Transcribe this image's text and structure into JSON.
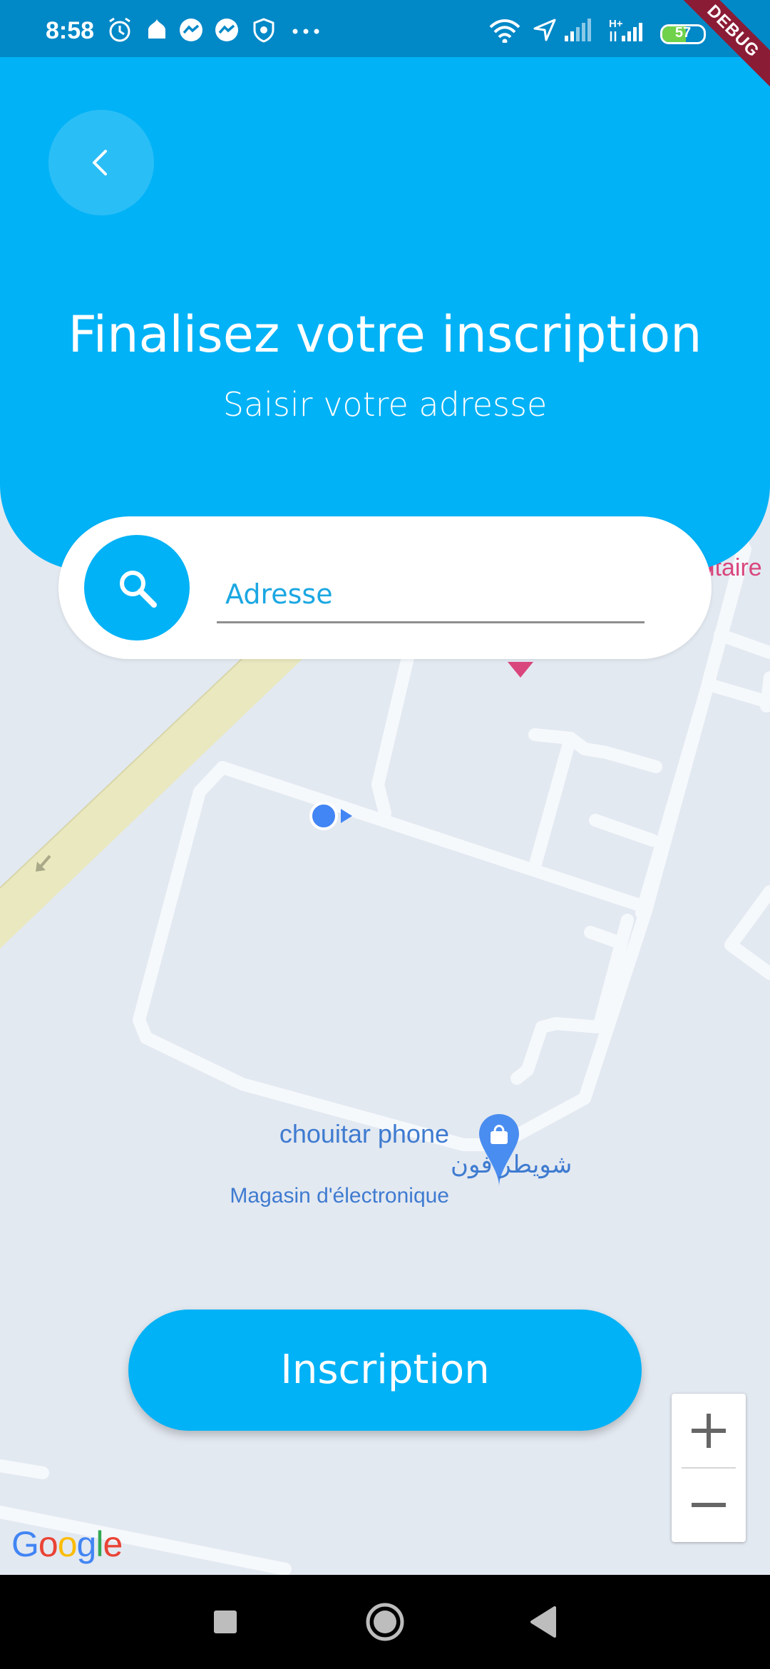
{
  "status_bar": {
    "time": "8:58",
    "battery_level": "57",
    "battery_fraction": 0.57,
    "debug_banner": "DEBUG",
    "left_icons": [
      "alarm-icon",
      "mosque-icon",
      "messenger-icon",
      "messenger-icon",
      "shield-icon",
      "more-icon"
    ],
    "right_icons": [
      "wifi-icon",
      "location-arrow-icon",
      "signal-icon",
      "hplus-signal-icon",
      "battery-icon"
    ]
  },
  "header": {
    "back_icon": "chevron-left-icon",
    "title": "Finalisez votre inscription",
    "subtitle": "Saisir votre adresse",
    "background_color": "#02b2f6"
  },
  "search": {
    "icon": "search-icon",
    "placeholder": "Adresse"
  },
  "map": {
    "poi_fragment": "itaire",
    "place_name": "chouitar phone",
    "place_name_arabic": "شويطر فون",
    "place_category": "Magasin d'électronique",
    "place_icon": "shopping-bag-pin-icon",
    "current_location_icon": "current-location-icon",
    "logo_text": "Google"
  },
  "actions": {
    "inscription_label": "Inscription"
  },
  "zoom": {
    "zoom_in_icon": "plus-icon",
    "zoom_out_icon": "minus-icon"
  },
  "nav_bar": {
    "recents_icon": "square-icon",
    "home_icon": "circle-icon",
    "back_icon": "triangle-back-icon"
  }
}
